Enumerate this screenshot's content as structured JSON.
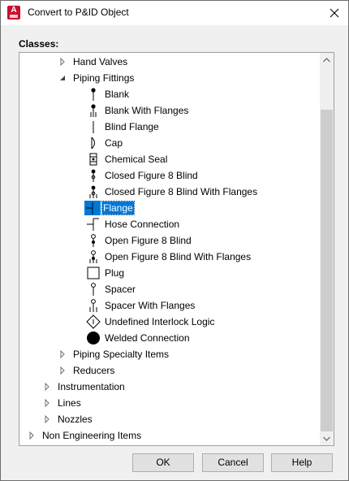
{
  "window": {
    "title": "Convert to P&ID Object",
    "app_icon_letter": "A"
  },
  "classes_label": "Classes:",
  "tree": {
    "hand_valves": "Hand Valves",
    "piping_fittings": "Piping Fittings",
    "items": [
      "Blank",
      "Blank With Flanges",
      "Blind Flange",
      "Cap",
      "Chemical Seal",
      "Closed Figure 8 Blind",
      "Closed Figure 8 Blind With Flanges",
      "Flange",
      "Hose Connection",
      "Open Figure 8 Blind",
      "Open Figure 8 Blind With Flanges",
      "Plug",
      "Spacer",
      "Spacer With Flanges",
      "Undefined Interlock Logic",
      "Welded Connection"
    ],
    "piping_specialty_items": "Piping Specialty Items",
    "reducers": "Reducers",
    "instrumentation": "Instrumentation",
    "lines": "Lines",
    "nozzles": "Nozzles",
    "non_engineering_items": "Non Engineering Items",
    "selected_item": "Flange"
  },
  "buttons": {
    "ok": "OK",
    "cancel": "Cancel",
    "help": "Help"
  },
  "colors": {
    "selection": "#0078d7",
    "app_icon": "#c8102e"
  }
}
